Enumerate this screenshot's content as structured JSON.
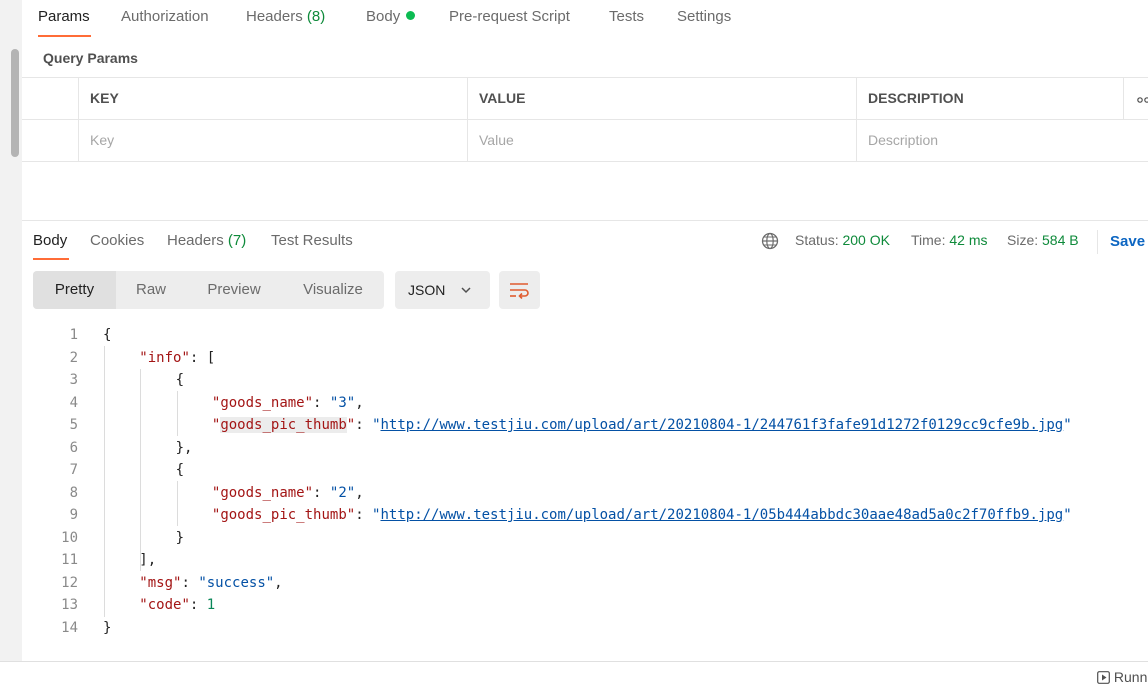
{
  "request_tabs": [
    {
      "label": "Params"
    },
    {
      "label": "Authorization"
    },
    {
      "label": "Headers",
      "count": "(8)"
    },
    {
      "label": "Body"
    },
    {
      "label": "Pre-request Script"
    },
    {
      "label": "Tests"
    },
    {
      "label": "Settings"
    }
  ],
  "query_params": {
    "title": "Query Params",
    "headers": {
      "key": "KEY",
      "value": "VALUE",
      "description": "DESCRIPTION"
    },
    "placeholders": {
      "key": "Key",
      "value": "Value",
      "description": "Description"
    }
  },
  "response_tabs": [
    {
      "label": "Body"
    },
    {
      "label": "Cookies"
    },
    {
      "label": "Headers",
      "count": "(7)"
    },
    {
      "label": "Test Results"
    }
  ],
  "status": {
    "status_label": "Status:",
    "status_value": "200 OK",
    "time_label": "Time:",
    "time_value": "42 ms",
    "size_label": "Size:",
    "size_value": "584 B",
    "save_label": "Save"
  },
  "view_modes": [
    "Pretty",
    "Raw",
    "Preview",
    "Visualize"
  ],
  "format_select": "JSON",
  "code_lines": [
    {
      "n": "1",
      "indent": 0,
      "parts": [
        {
          "t": "{",
          "c": "punc"
        }
      ]
    },
    {
      "n": "2",
      "indent": 1,
      "parts": [
        {
          "t": "\"info\"",
          "c": "key"
        },
        {
          "t": ": [",
          "c": "punc"
        }
      ]
    },
    {
      "n": "3",
      "indent": 2,
      "parts": [
        {
          "t": "{",
          "c": "punc"
        }
      ]
    },
    {
      "n": "4",
      "indent": 3,
      "parts": [
        {
          "t": "\"goods_name\"",
          "c": "key"
        },
        {
          "t": ": ",
          "c": "punc"
        },
        {
          "t": "\"3\"",
          "c": "str"
        },
        {
          "t": ",",
          "c": "punc"
        }
      ]
    },
    {
      "n": "5",
      "indent": 3,
      "parts": [
        {
          "t": "\"",
          "c": "key"
        },
        {
          "t": "goods_pic_thumb",
          "c": "key hl"
        },
        {
          "t": "\"",
          "c": "key"
        },
        {
          "t": ": ",
          "c": "punc"
        },
        {
          "t": "\"",
          "c": "str"
        },
        {
          "t": "http://www.testjiu.com/upload/art/20210804-1/244761f3fafe91d1272f0129cc9cfe9b.jpg",
          "c": "url"
        },
        {
          "t": "\"",
          "c": "str"
        }
      ]
    },
    {
      "n": "6",
      "indent": 2,
      "parts": [
        {
          "t": "},",
          "c": "punc"
        }
      ]
    },
    {
      "n": "7",
      "indent": 2,
      "parts": [
        {
          "t": "{",
          "c": "punc"
        }
      ]
    },
    {
      "n": "8",
      "indent": 3,
      "parts": [
        {
          "t": "\"goods_name\"",
          "c": "key"
        },
        {
          "t": ": ",
          "c": "punc"
        },
        {
          "t": "\"2\"",
          "c": "str"
        },
        {
          "t": ",",
          "c": "punc"
        }
      ]
    },
    {
      "n": "9",
      "indent": 3,
      "parts": [
        {
          "t": "\"goods_pic_thumb\"",
          "c": "key"
        },
        {
          "t": ": ",
          "c": "punc"
        },
        {
          "t": "\"",
          "c": "str"
        },
        {
          "t": "http://www.testjiu.com/upload/art/20210804-1/05b444abbdc30aae48ad5a0c2f70ffb9.jpg",
          "c": "url"
        },
        {
          "t": "\"",
          "c": "str"
        }
      ]
    },
    {
      "n": "10",
      "indent": 2,
      "parts": [
        {
          "t": "}",
          "c": "punc"
        }
      ]
    },
    {
      "n": "11",
      "indent": 1,
      "parts": [
        {
          "t": "],",
          "c": "punc"
        }
      ]
    },
    {
      "n": "12",
      "indent": 1,
      "parts": [
        {
          "t": "\"msg\"",
          "c": "key"
        },
        {
          "t": ": ",
          "c": "punc"
        },
        {
          "t": "\"success\"",
          "c": "str"
        },
        {
          "t": ",",
          "c": "punc"
        }
      ]
    },
    {
      "n": "13",
      "indent": 1,
      "parts": [
        {
          "t": "\"code\"",
          "c": "key"
        },
        {
          "t": ": ",
          "c": "punc"
        },
        {
          "t": "1",
          "c": "num"
        }
      ]
    },
    {
      "n": "14",
      "indent": 0,
      "parts": [
        {
          "t": "}",
          "c": "punc"
        }
      ]
    }
  ],
  "footer": {
    "runner_label": "Runn"
  },
  "colors": {
    "accent": "#ff6c37",
    "success": "#0e8a3a",
    "link": "#0d66c2",
    "status_dot": "#0cbb52"
  }
}
